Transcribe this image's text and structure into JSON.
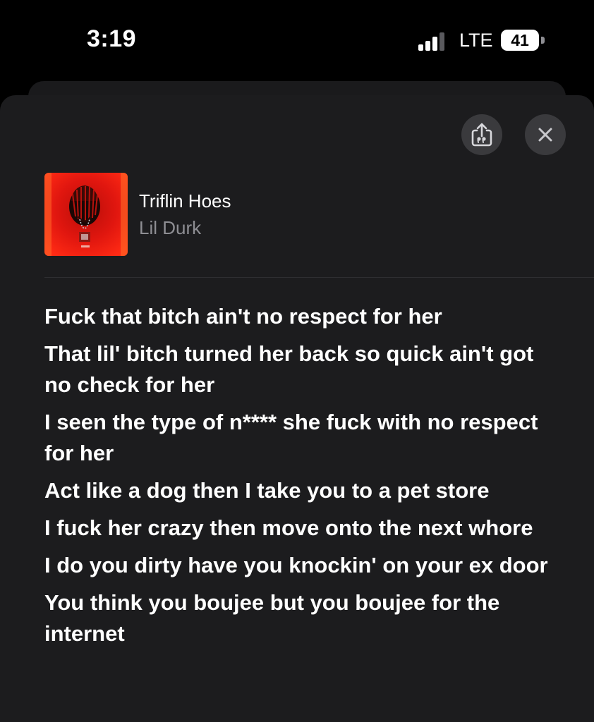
{
  "status_bar": {
    "time": "3:19",
    "network": "LTE",
    "battery": "41"
  },
  "actions": {
    "share_icon": "lyrics-share-icon",
    "close_icon": "close-icon"
  },
  "track": {
    "title": "Triflin Hoes",
    "artist": "Lil Durk",
    "artwork_colors": [
      "#e0160f",
      "#1a0705",
      "#ff5a1c"
    ]
  },
  "lyrics": [
    "Fuck that bitch ain't no respect for her",
    "That lil' bitch turned her back so quick ain't got no check for her",
    "I seen the type of n**** she fuck with no respect for her",
    "Act like a dog then I take you to a pet store",
    "I fuck her crazy then move onto the next whore",
    "I do you dirty have you knockin' on your ex door",
    "You think you boujee but you boujee for the internet"
  ]
}
